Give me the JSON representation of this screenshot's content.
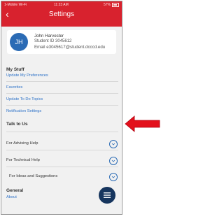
{
  "status": {
    "carrier": "1-Mobile Wi-Fi",
    "time": "11:23 AM",
    "battery": "57%"
  },
  "header": {
    "back_icon": "chevron-left-icon",
    "title": "Settings"
  },
  "profile": {
    "initials": "JH",
    "name": "John Harvester",
    "student_id": "Student ID 3045612",
    "email": "Email e3045617@student.dcccd.edu"
  },
  "my_stuff": {
    "heading": "My Stuff",
    "links": [
      "Update My Preferences",
      "Favorites",
      "Update To Do Topics",
      "Notification Settings"
    ]
  },
  "talk": {
    "heading": "Talk to Us",
    "items": [
      "For Advising Help",
      "For Technical Help",
      "For Ideas and Suggestions"
    ]
  },
  "general": {
    "heading": "General",
    "link": "About"
  },
  "colors": {
    "header": "#d8222e",
    "link": "#2f73c8",
    "menu_button": "#16355e",
    "arrow": "#e3101b"
  },
  "icons": {
    "chevron": "chevron-down-icon",
    "menu": "hamburger-menu-icon",
    "annotation": "red-arrow-icon"
  }
}
